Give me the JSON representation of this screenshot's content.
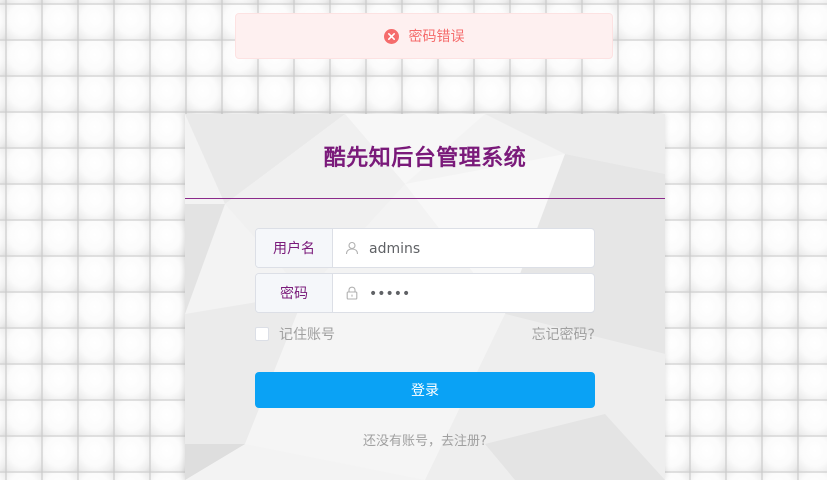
{
  "toast": {
    "message": "密码错误",
    "icon": "close-circle-icon",
    "color": "#f56c6c"
  },
  "login": {
    "title": "酷先知后台管理系统",
    "username_label": "用户名",
    "username_value": "admins",
    "username_icon": "user-icon",
    "password_label": "密码",
    "password_value": "•••••",
    "password_icon": "lock-icon",
    "remember_label": "记住账号",
    "forgot_label": "忘记密码?",
    "login_label": "登录",
    "register_label": "还没有账号，去注册?"
  },
  "colors": {
    "accent": "#7a1a7a",
    "button": "#0aa2f5"
  }
}
